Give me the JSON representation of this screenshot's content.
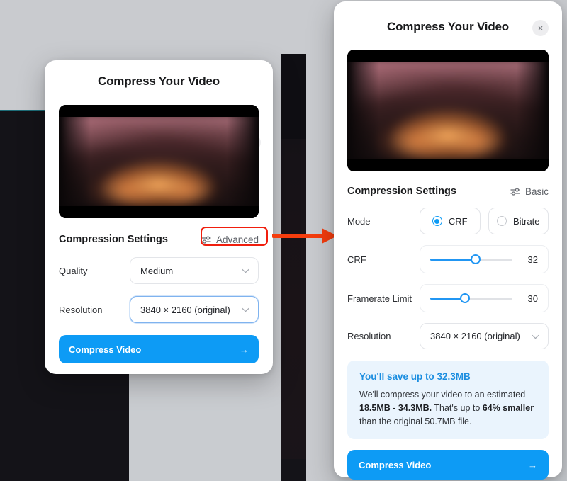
{
  "basic_dialog": {
    "title": "Compress Your Video",
    "close_label": "×",
    "section_title": "Compression Settings",
    "mode_toggle_label": "Advanced",
    "mode_toggle_icon": "sliders-icon",
    "rows": [
      {
        "label": "Quality",
        "value": "Medium",
        "focused": false
      },
      {
        "label": "Resolution",
        "value": "3840 × 2160 (original)",
        "focused": true
      }
    ],
    "cta_label": "Compress Video",
    "cta_arrow": "→"
  },
  "advanced_dialog": {
    "title": "Compress Your Video",
    "close_label": "×",
    "section_title": "Compression Settings",
    "mode_toggle_label": "Basic",
    "mode_toggle_icon": "sliders-icon",
    "mode_row_label": "Mode",
    "mode_options": [
      {
        "label": "CRF",
        "selected": true
      },
      {
        "label": "Bitrate",
        "selected": false
      }
    ],
    "sliders": [
      {
        "label": "CRF",
        "value": "32",
        "percent": 55
      },
      {
        "label": "Framerate Limit",
        "value": "30",
        "percent": 42
      }
    ],
    "resolution_row": {
      "label": "Resolution",
      "value": "3840 × 2160 (original)"
    },
    "savings": {
      "headline": "You'll save up to 32.3MB",
      "line1": "We'll compress your video to an estimated",
      "estimate": "18.5MB - 34.3MB.",
      "mid": " That's up to ",
      "percent": "64% smaller",
      "line3": "than the original 50.7MB file."
    },
    "cta_label": "Compress Video",
    "cta_arrow": "→"
  },
  "annotations": {
    "highlight_target": "Advanced",
    "arrow_color": "#f53d0d",
    "box_color": "#f01e0d"
  },
  "colors": {
    "accent": "#0d9bf5",
    "slider": "#2196f3",
    "savings_bg": "#eaf4fd",
    "savings_text": "#1c8ee0",
    "page_bg": "#c9ccd0"
  }
}
